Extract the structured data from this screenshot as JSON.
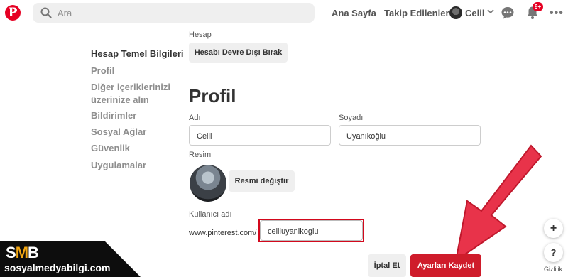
{
  "colors": {
    "brand": "#e60023",
    "save": "#cf1c2b",
    "highlight": "#d3081c",
    "arrow": "#e8334a",
    "watermark_accent": "#f3a712"
  },
  "header": {
    "logo_letter": "P",
    "search_placeholder": "Ara",
    "nav_home": "Ana Sayfa",
    "nav_following": "Takip Edilenler",
    "user_name": "Celil",
    "notification_badge": "9+",
    "icons": [
      "pinterest-logo",
      "search-icon",
      "chevron-down-icon",
      "chat-icon",
      "bell-icon",
      "more-icon"
    ]
  },
  "sidebar": {
    "items": [
      {
        "label": "Hesap Temel Bilgileri",
        "active": true
      },
      {
        "label": "Profil"
      },
      {
        "label": "Diğer içeriklerinizi"
      },
      {
        "label": "üzerinize alın"
      },
      {
        "label": "Bildirimler"
      },
      {
        "label": "Sosyal Ağlar"
      },
      {
        "label": "Güvenlik"
      },
      {
        "label": "Uygulamalar"
      }
    ]
  },
  "account": {
    "section_label": "Hesap",
    "deactivate_button": "Hesabı Devre Dışı Bırak"
  },
  "profile": {
    "title": "Profil",
    "first_name_label": "Adı",
    "first_name_value": "Celil",
    "last_name_label": "Soyadı",
    "last_name_value": "Uyanıkoğlu",
    "picture_label": "Resim",
    "change_picture_button": "Resmi değiştir",
    "username_label": "Kullanıcı adı",
    "url_prefix": "www.pinterest.com/",
    "username_value": "celiluyanikoglu"
  },
  "actions": {
    "cancel": "İptal Et",
    "save": "Ayarları Kaydet"
  },
  "floating": {
    "plus": "+",
    "help": "?",
    "privacy": "Gizlilik"
  },
  "watermark": {
    "logo_s": "S",
    "logo_m": "M",
    "logo_b": "B",
    "site": "sosyalmedyabilgi.com"
  }
}
